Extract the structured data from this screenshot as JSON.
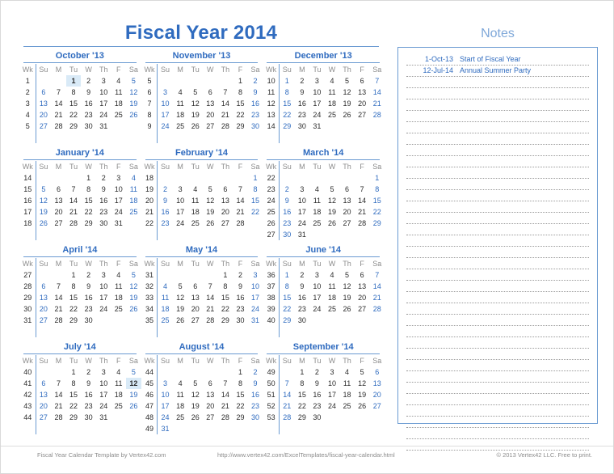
{
  "page": {
    "title": "Fiscal Year 2014",
    "notes_header": "Notes"
  },
  "colors": {
    "accent": "#2f6bbf",
    "rule": "#6b9bd2",
    "notes_header": "#7fa8d9",
    "weekend_day": "#2f6bbf",
    "weekday": "#2b2b2b",
    "dow_header": "#8c8c8c",
    "highlight_bg": "#d9eaf7",
    "footer_text": "#8c8c8c"
  },
  "dow_headers": [
    "Su",
    "M",
    "Tu",
    "W",
    "Th",
    "F",
    "Sa"
  ],
  "wk_header": "Wk",
  "months": [
    {
      "name": "October '13",
      "weeks": [
        {
          "wk": "1",
          "days": [
            "",
            "",
            "1",
            "2",
            "3",
            "4",
            "5"
          ],
          "highlight": [
            2
          ]
        },
        {
          "wk": "2",
          "days": [
            "6",
            "7",
            "8",
            "9",
            "10",
            "11",
            "12"
          ]
        },
        {
          "wk": "3",
          "days": [
            "13",
            "14",
            "15",
            "16",
            "17",
            "18",
            "19"
          ]
        },
        {
          "wk": "4",
          "days": [
            "20",
            "21",
            "22",
            "23",
            "24",
            "25",
            "26"
          ]
        },
        {
          "wk": "5",
          "days": [
            "27",
            "28",
            "29",
            "30",
            "31",
            "",
            ""
          ]
        },
        {
          "wk": "",
          "days": [
            "",
            "",
            "",
            "",
            "",
            "",
            ""
          ]
        }
      ]
    },
    {
      "name": "November '13",
      "weeks": [
        {
          "wk": "5",
          "days": [
            "",
            "",
            "",
            "",
            "",
            "1",
            "2"
          ]
        },
        {
          "wk": "6",
          "days": [
            "3",
            "4",
            "5",
            "6",
            "7",
            "8",
            "9"
          ]
        },
        {
          "wk": "7",
          "days": [
            "10",
            "11",
            "12",
            "13",
            "14",
            "15",
            "16"
          ]
        },
        {
          "wk": "8",
          "days": [
            "17",
            "18",
            "19",
            "20",
            "21",
            "22",
            "23"
          ]
        },
        {
          "wk": "9",
          "days": [
            "24",
            "25",
            "26",
            "27",
            "28",
            "29",
            "30"
          ]
        },
        {
          "wk": "",
          "days": [
            "",
            "",
            "",
            "",
            "",
            "",
            ""
          ]
        }
      ]
    },
    {
      "name": "December '13",
      "weeks": [
        {
          "wk": "10",
          "days": [
            "1",
            "2",
            "3",
            "4",
            "5",
            "6",
            "7"
          ]
        },
        {
          "wk": "11",
          "days": [
            "8",
            "9",
            "10",
            "11",
            "12",
            "13",
            "14"
          ]
        },
        {
          "wk": "12",
          "days": [
            "15",
            "16",
            "17",
            "18",
            "19",
            "20",
            "21"
          ]
        },
        {
          "wk": "13",
          "days": [
            "22",
            "23",
            "24",
            "25",
            "26",
            "27",
            "28"
          ]
        },
        {
          "wk": "14",
          "days": [
            "29",
            "30",
            "31",
            "",
            "",
            "",
            ""
          ]
        },
        {
          "wk": "",
          "days": [
            "",
            "",
            "",
            "",
            "",
            "",
            ""
          ]
        }
      ]
    },
    {
      "name": "January '14",
      "weeks": [
        {
          "wk": "14",
          "days": [
            "",
            "",
            "",
            "1",
            "2",
            "3",
            "4"
          ]
        },
        {
          "wk": "15",
          "days": [
            "5",
            "6",
            "7",
            "8",
            "9",
            "10",
            "11"
          ]
        },
        {
          "wk": "16",
          "days": [
            "12",
            "13",
            "14",
            "15",
            "16",
            "17",
            "18"
          ]
        },
        {
          "wk": "17",
          "days": [
            "19",
            "20",
            "21",
            "22",
            "23",
            "24",
            "25"
          ]
        },
        {
          "wk": "18",
          "days": [
            "26",
            "27",
            "28",
            "29",
            "30",
            "31",
            ""
          ]
        },
        {
          "wk": "",
          "days": [
            "",
            "",
            "",
            "",
            "",
            "",
            ""
          ]
        }
      ]
    },
    {
      "name": "February '14",
      "weeks": [
        {
          "wk": "18",
          "days": [
            "",
            "",
            "",
            "",
            "",
            "",
            "1"
          ]
        },
        {
          "wk": "19",
          "days": [
            "2",
            "3",
            "4",
            "5",
            "6",
            "7",
            "8"
          ]
        },
        {
          "wk": "20",
          "days": [
            "9",
            "10",
            "11",
            "12",
            "13",
            "14",
            "15"
          ]
        },
        {
          "wk": "21",
          "days": [
            "16",
            "17",
            "18",
            "19",
            "20",
            "21",
            "22"
          ]
        },
        {
          "wk": "22",
          "days": [
            "23",
            "24",
            "25",
            "26",
            "27",
            "28",
            ""
          ]
        },
        {
          "wk": "",
          "days": [
            "",
            "",
            "",
            "",
            "",
            "",
            ""
          ]
        }
      ]
    },
    {
      "name": "March '14",
      "weeks": [
        {
          "wk": "22",
          "days": [
            "",
            "",
            "",
            "",
            "",
            "",
            "1"
          ]
        },
        {
          "wk": "23",
          "days": [
            "2",
            "3",
            "4",
            "5",
            "6",
            "7",
            "8"
          ]
        },
        {
          "wk": "24",
          "days": [
            "9",
            "10",
            "11",
            "12",
            "13",
            "14",
            "15"
          ]
        },
        {
          "wk": "25",
          "days": [
            "16",
            "17",
            "18",
            "19",
            "20",
            "21",
            "22"
          ]
        },
        {
          "wk": "26",
          "days": [
            "23",
            "24",
            "25",
            "26",
            "27",
            "28",
            "29"
          ]
        },
        {
          "wk": "27",
          "days": [
            "30",
            "31",
            "",
            "",
            "",
            "",
            ""
          ]
        }
      ]
    },
    {
      "name": "April '14",
      "weeks": [
        {
          "wk": "27",
          "days": [
            "",
            "",
            "1",
            "2",
            "3",
            "4",
            "5"
          ]
        },
        {
          "wk": "28",
          "days": [
            "6",
            "7",
            "8",
            "9",
            "10",
            "11",
            "12"
          ]
        },
        {
          "wk": "29",
          "days": [
            "13",
            "14",
            "15",
            "16",
            "17",
            "18",
            "19"
          ]
        },
        {
          "wk": "30",
          "days": [
            "20",
            "21",
            "22",
            "23",
            "24",
            "25",
            "26"
          ]
        },
        {
          "wk": "31",
          "days": [
            "27",
            "28",
            "29",
            "30",
            "",
            "",
            ""
          ]
        },
        {
          "wk": "",
          "days": [
            "",
            "",
            "",
            "",
            "",
            "",
            ""
          ]
        }
      ]
    },
    {
      "name": "May '14",
      "weeks": [
        {
          "wk": "31",
          "days": [
            "",
            "",
            "",
            "",
            "1",
            "2",
            "3"
          ]
        },
        {
          "wk": "32",
          "days": [
            "4",
            "5",
            "6",
            "7",
            "8",
            "9",
            "10"
          ]
        },
        {
          "wk": "33",
          "days": [
            "11",
            "12",
            "13",
            "14",
            "15",
            "16",
            "17"
          ]
        },
        {
          "wk": "34",
          "days": [
            "18",
            "19",
            "20",
            "21",
            "22",
            "23",
            "24"
          ]
        },
        {
          "wk": "35",
          "days": [
            "25",
            "26",
            "27",
            "28",
            "29",
            "30",
            "31"
          ]
        },
        {
          "wk": "",
          "days": [
            "",
            "",
            "",
            "",
            "",
            "",
            ""
          ]
        }
      ]
    },
    {
      "name": "June '14",
      "weeks": [
        {
          "wk": "36",
          "days": [
            "1",
            "2",
            "3",
            "4",
            "5",
            "6",
            "7"
          ]
        },
        {
          "wk": "37",
          "days": [
            "8",
            "9",
            "10",
            "11",
            "12",
            "13",
            "14"
          ]
        },
        {
          "wk": "38",
          "days": [
            "15",
            "16",
            "17",
            "18",
            "19",
            "20",
            "21"
          ]
        },
        {
          "wk": "39",
          "days": [
            "22",
            "23",
            "24",
            "25",
            "26",
            "27",
            "28"
          ]
        },
        {
          "wk": "40",
          "days": [
            "29",
            "30",
            "",
            "",
            "",
            "",
            ""
          ]
        },
        {
          "wk": "",
          "days": [
            "",
            "",
            "",
            "",
            "",
            "",
            ""
          ]
        }
      ]
    },
    {
      "name": "July '14",
      "weeks": [
        {
          "wk": "40",
          "days": [
            "",
            "",
            "1",
            "2",
            "3",
            "4",
            "5"
          ]
        },
        {
          "wk": "41",
          "days": [
            "6",
            "7",
            "8",
            "9",
            "10",
            "11",
            "12"
          ],
          "highlight": [
            6
          ]
        },
        {
          "wk": "42",
          "days": [
            "13",
            "14",
            "15",
            "16",
            "17",
            "18",
            "19"
          ]
        },
        {
          "wk": "43",
          "days": [
            "20",
            "21",
            "22",
            "23",
            "24",
            "25",
            "26"
          ]
        },
        {
          "wk": "44",
          "days": [
            "27",
            "28",
            "29",
            "30",
            "31",
            "",
            ""
          ]
        },
        {
          "wk": "",
          "days": [
            "",
            "",
            "",
            "",
            "",
            "",
            ""
          ]
        }
      ]
    },
    {
      "name": "August '14",
      "weeks": [
        {
          "wk": "44",
          "days": [
            "",
            "",
            "",
            "",
            "",
            "1",
            "2"
          ]
        },
        {
          "wk": "45",
          "days": [
            "3",
            "4",
            "5",
            "6",
            "7",
            "8",
            "9"
          ]
        },
        {
          "wk": "46",
          "days": [
            "10",
            "11",
            "12",
            "13",
            "14",
            "15",
            "16"
          ]
        },
        {
          "wk": "47",
          "days": [
            "17",
            "18",
            "19",
            "20",
            "21",
            "22",
            "23"
          ]
        },
        {
          "wk": "48",
          "days": [
            "24",
            "25",
            "26",
            "27",
            "28",
            "29",
            "30"
          ]
        },
        {
          "wk": "49",
          "days": [
            "31",
            "",
            "",
            "",
            "",
            "",
            ""
          ]
        }
      ]
    },
    {
      "name": "September '14",
      "weeks": [
        {
          "wk": "49",
          "days": [
            "",
            "1",
            "2",
            "3",
            "4",
            "5",
            "6"
          ]
        },
        {
          "wk": "50",
          "days": [
            "7",
            "8",
            "9",
            "10",
            "11",
            "12",
            "13"
          ]
        },
        {
          "wk": "51",
          "days": [
            "14",
            "15",
            "16",
            "17",
            "18",
            "19",
            "20"
          ]
        },
        {
          "wk": "52",
          "days": [
            "21",
            "22",
            "23",
            "24",
            "25",
            "26",
            "27"
          ]
        },
        {
          "wk": "53",
          "days": [
            "28",
            "29",
            "30",
            "",
            "",
            "",
            ""
          ]
        },
        {
          "wk": "",
          "days": [
            "",
            "",
            "",
            "",
            "",
            "",
            ""
          ]
        }
      ]
    }
  ],
  "notes": {
    "entries": [
      {
        "date": "1-Oct-13",
        "text": "Start of Fiscal Year"
      },
      {
        "date": "12-Jul-14",
        "text": "Annual Summer Party"
      }
    ],
    "blank_line_count": 33
  },
  "footer": {
    "left": "Fiscal Year Calendar Template by Vertex42.com",
    "middle": "http://www.vertex42.com/ExcelTemplates/fiscal-year-calendar.html",
    "right": "© 2013 Vertex42 LLC. Free to print."
  }
}
